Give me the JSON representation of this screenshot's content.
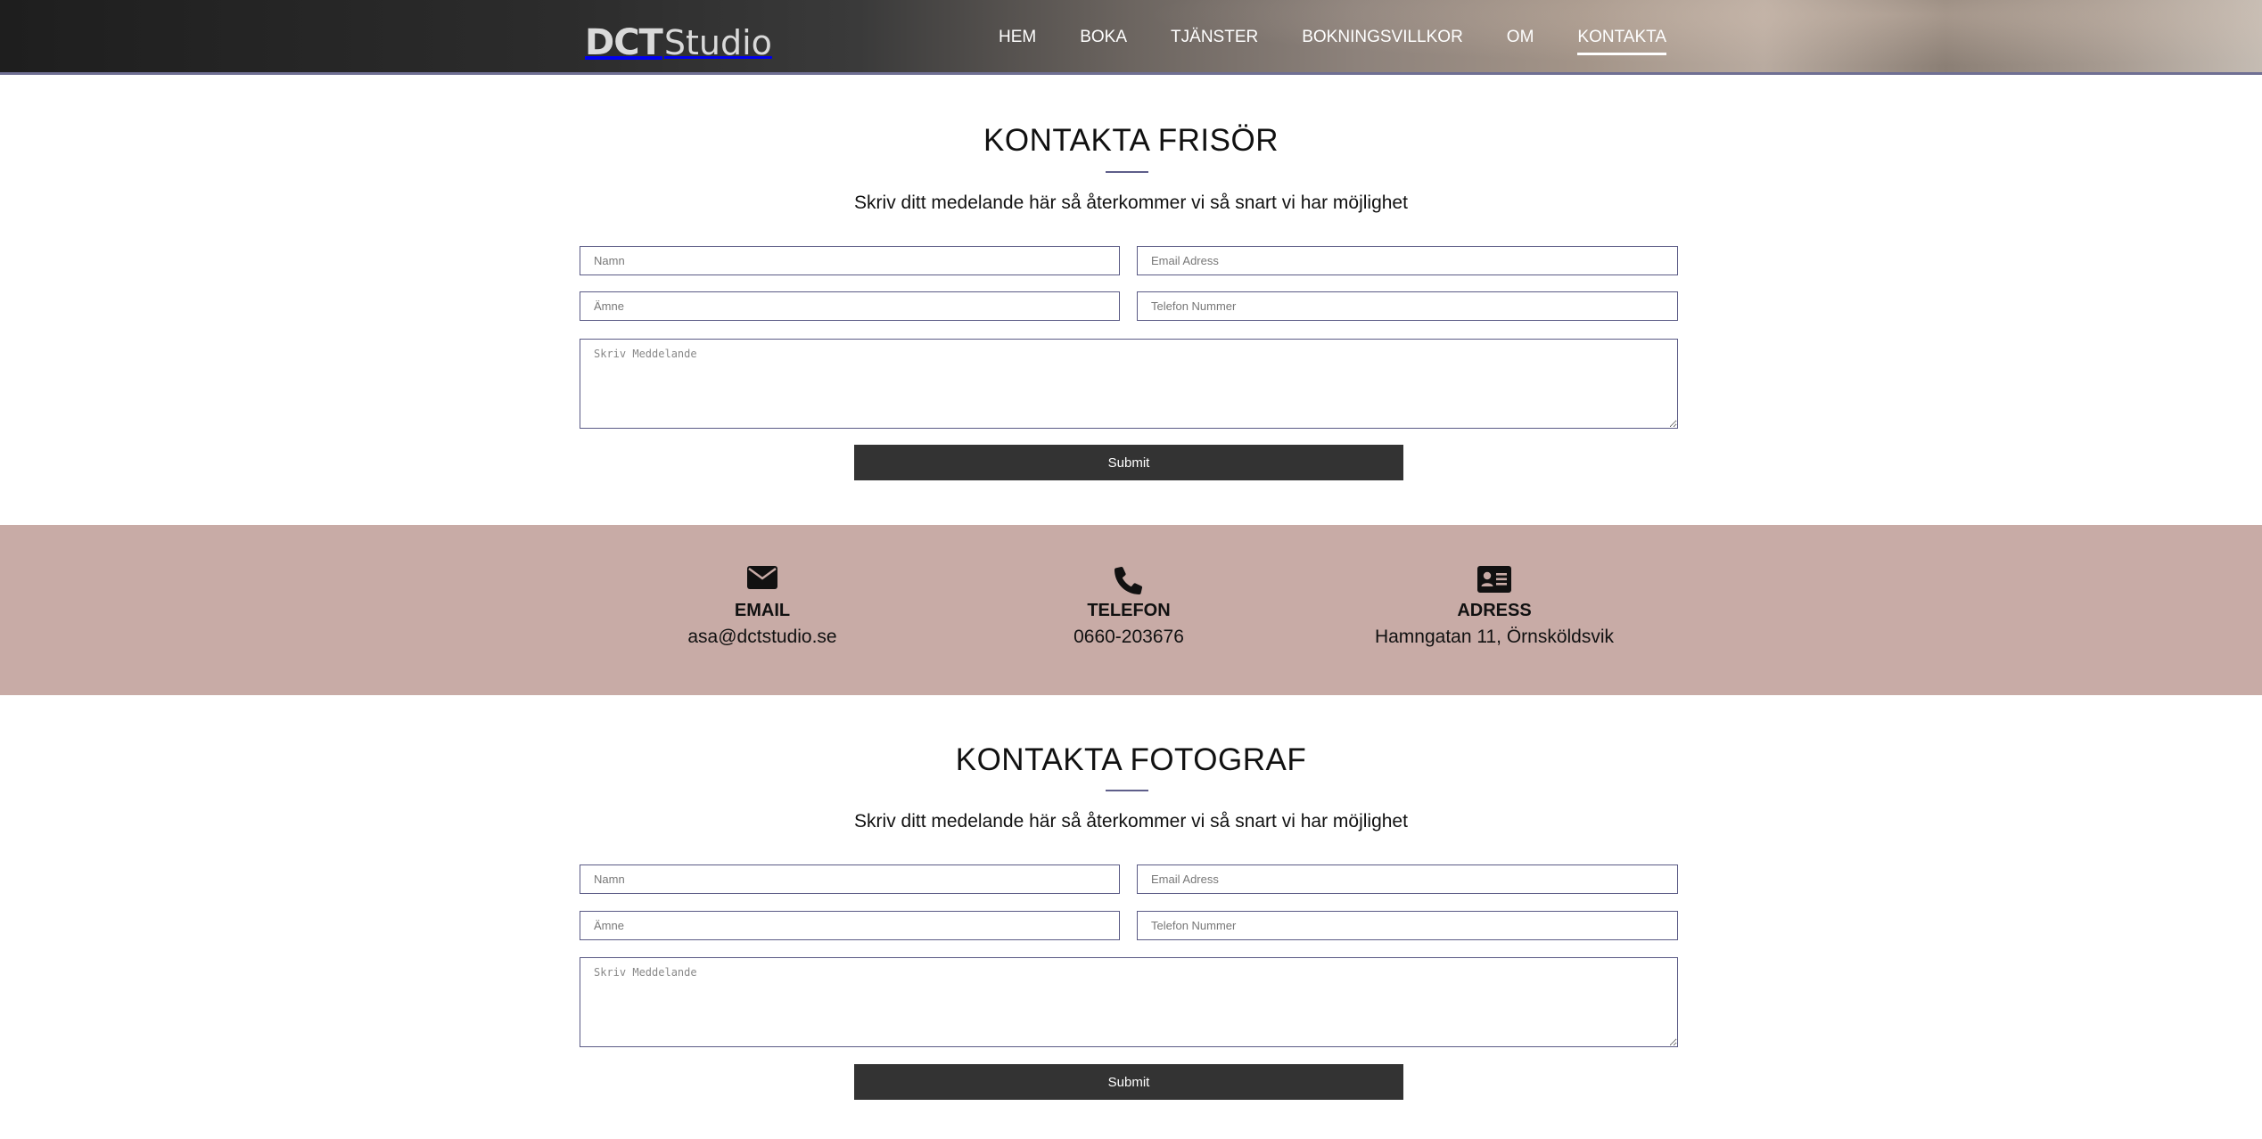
{
  "header": {
    "logo": {
      "part1": "DCT",
      "part2": "Studio"
    },
    "nav": [
      {
        "label": "HEM",
        "active": false
      },
      {
        "label": "BOKA",
        "active": false
      },
      {
        "label": "TJÄNSTER",
        "active": false
      },
      {
        "label": "BOKNINGSVILLKOR",
        "active": false
      },
      {
        "label": "OM",
        "active": false
      },
      {
        "label": "KONTAKTA",
        "active": true
      }
    ]
  },
  "hairdresser_form": {
    "title": "KONTAKTA FRISÖR",
    "subtitle": "Skriv ditt medelande här så återkommer vi så snart vi har möjlighet",
    "name_placeholder": "Namn",
    "email_placeholder": "Email Adress",
    "subject_placeholder": "Ämne",
    "phone_placeholder": "Telefon Nummer",
    "message_placeholder": "Skriv Meddelande",
    "submit_label": "Submit"
  },
  "contact_info": {
    "email": {
      "icon": "envelope-icon",
      "label": "EMAIL",
      "value": "asa@dctstudio.se"
    },
    "phone": {
      "icon": "phone-icon",
      "label": "TELEFON",
      "value": "0660-203676"
    },
    "address": {
      "icon": "address-card-icon",
      "label": "ADRESS",
      "value": "Hamngatan 11, Örnsköldsvik"
    }
  },
  "photographer_form": {
    "title": "KONTAKTA FOTOGRAF",
    "subtitle": "Skriv ditt medelande här så återkommer vi så snart vi har möjlighet",
    "name_placeholder": "Namn",
    "email_placeholder": "Email Adress",
    "subject_placeholder": "Ämne",
    "phone_placeholder": "Telefon Nummer",
    "message_placeholder": "Skriv Meddelande",
    "submit_label": "Submit"
  },
  "colors": {
    "band_background": "#c8aba6",
    "submit_background": "#333333",
    "field_border": "#5a5a85",
    "accent_rule": "#5e5e8a"
  }
}
